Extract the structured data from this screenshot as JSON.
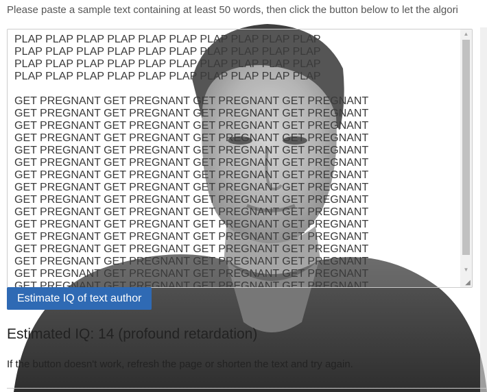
{
  "instructions": "Please paste a sample text containing at least 50 words, then click the button below to let the algori",
  "sample_text": {
    "lines": [
      "PLAP PLAP PLAP PLAP PLAP PLAP PLAP PLAP PLAP PLAP",
      "PLAP PLAP PLAP PLAP PLAP PLAP PLAP PLAP PLAP PLAP",
      "PLAP PLAP PLAP PLAP PLAP PLAP PLAP PLAP PLAP PLAP",
      "PLAP PLAP PLAP PLAP PLAP PLAP PLAP PLAP PLAP PLAP",
      "",
      "GET PREGNANT GET PREGNANT GET PREGNANT GET PREGNANT",
      "GET PREGNANT GET PREGNANT GET PREGNANT GET PREGNANT",
      "GET PREGNANT GET PREGNANT GET PREGNANT GET PREGNANT",
      "GET PREGNANT GET PREGNANT GET PREGNANT GET PREGNANT",
      "GET PREGNANT GET PREGNANT GET PREGNANT GET PREGNANT",
      "GET PREGNANT GET PREGNANT GET PREGNANT GET PREGNANT",
      "GET PREGNANT GET PREGNANT GET PREGNANT GET PREGNANT",
      "GET PREGNANT GET PREGNANT GET PREGNANT GET PREGNANT",
      "GET PREGNANT GET PREGNANT GET PREGNANT GET PREGNANT",
      "GET PREGNANT GET PREGNANT GET PREGNANT GET PREGNANT",
      "GET PREGNANT GET PREGNANT GET PREGNANT GET PREGNANT",
      "GET PREGNANT GET PREGNANT GET PREGNANT GET PREGNANT",
      "GET PREGNANT GET PREGNANT GET PREGNANT GET PREGNANT",
      "GET PREGNANT GET PREGNANT GET PREGNANT GET PREGNANT",
      "GET PREGNANT GET PREGNANT GET PREGNANT GET PREGNANT",
      "GET PREGNANT GET PREGNANT GET PREGNANT GET PREGNANT"
    ]
  },
  "button": {
    "label": "Estimate IQ of text author"
  },
  "result": {
    "text": "Estimated IQ: 14 (profound retardation)"
  },
  "note": "If the button doesn't work, refresh the page or shorten the text and try again.",
  "colors": {
    "button_bg": "#2f6ab4",
    "button_text": "#ffffff"
  },
  "icons": {
    "scroll_up": "arrow-up-icon",
    "scroll_down": "arrow-down-icon",
    "resize": "resize-grip-icon",
    "background": "person-photo"
  }
}
